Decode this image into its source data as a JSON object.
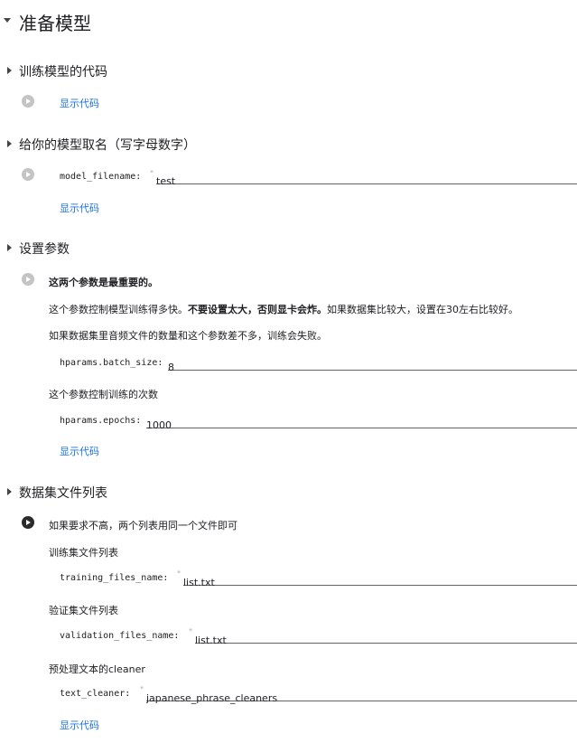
{
  "sections": {
    "prepare_model": {
      "title": "准备模型"
    },
    "training_code": {
      "title": "训练模型的代码",
      "show_code": "显示代码"
    },
    "model_name": {
      "title": "给你的模型取名（写字母数字）",
      "param_label": "model_filename:",
      "param_value": "test",
      "show_code": "显示代码"
    },
    "params": {
      "title": "设置参数",
      "note_bold": "这两个参数是最重要的。",
      "desc1_pre": "这个参数控制模型训练得多快。",
      "desc1_bold": "不要设置太大，否则显卡会炸。",
      "desc1_post": "如果数据集比较大，设置在30左右比较好。",
      "desc2": "如果数据集里音频文件的数量和这个参数差不多，训练会失败。",
      "batch_label": "hparams.batch_size:",
      "batch_value": "8",
      "epochs_desc": "这个参数控制训练的次数",
      "epochs_label": "hparams.epochs:",
      "epochs_value": "1000",
      "show_code": "显示代码"
    },
    "dataset": {
      "title": "数据集文件列表",
      "note": "如果要求不高，两个列表用同一个文件即可",
      "train_desc": "训练集文件列表",
      "train_label": "training_files_name:",
      "train_value": "list.txt",
      "val_desc": "验证集文件列表",
      "val_label": "validation_files_name:",
      "val_value": "list.txt",
      "cleaner_desc": "预处理文本的cleaner",
      "cleaner_label": "text_cleaner:",
      "cleaner_value": "japanese_phrase_cleaners",
      "show_code": "显示代码"
    }
  }
}
